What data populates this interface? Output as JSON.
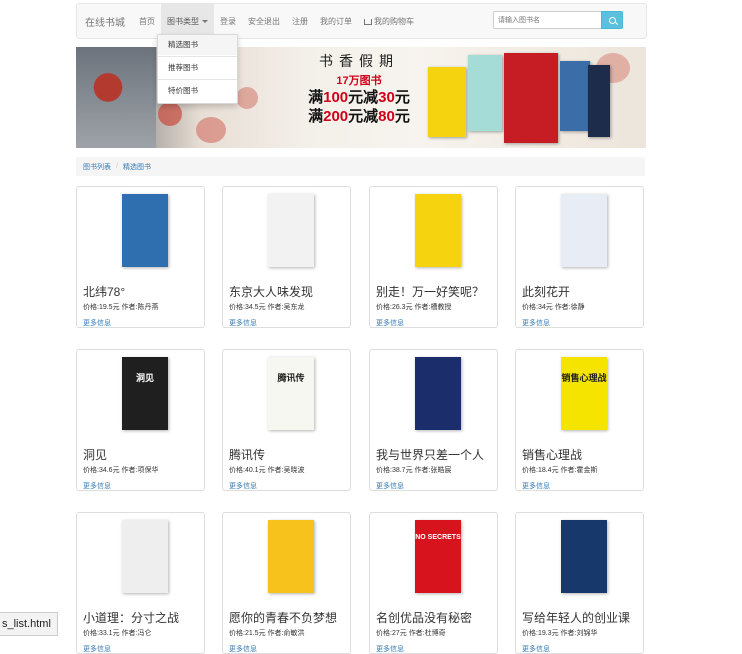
{
  "navbar": {
    "brand": "在线书城",
    "items": [
      "首页",
      "图书类型",
      "登录",
      "安全退出",
      "注册",
      "我的订单",
      "我的购物车"
    ],
    "search_placeholder": "请输入图书名"
  },
  "dropdown": {
    "items": [
      "精选图书",
      "推荐图书",
      "特价图书"
    ]
  },
  "banner": {
    "line1": "书香假期",
    "line2": "17万图书",
    "line3_pre": "满",
    "line3_a": "100",
    "line3_mid": "元减",
    "line3_b": "30",
    "line3_post": "元",
    "line4_pre": "满",
    "line4_a": "200",
    "line4_mid": "元减",
    "line4_b": "80",
    "line4_post": "元"
  },
  "breadcrumb": {
    "home": "图书列表",
    "current": "精选图书"
  },
  "books": [
    {
      "title": "北纬78°",
      "price": "价格:19.5元",
      "author": "作者:陈丹燕",
      "more": "更多信息",
      "cover_color": "#2f6fb0",
      "cover_text": ""
    },
    {
      "title": "东京大人味发现",
      "price": "价格:34.5元",
      "author": "作者:吴东龙",
      "more": "更多信息",
      "cover_color": "#f2f2f2",
      "cover_text": ""
    },
    {
      "title": "别走！万一好笑呢？",
      "price": "价格:26.3元",
      "author": "作者:槽教授",
      "more": "更多信息",
      "cover_color": "#f5d30f",
      "cover_text": ""
    },
    {
      "title": "此刻花开",
      "price": "价格:34元",
      "author": "作者:徐静",
      "more": "更多信息",
      "cover_color": "#e8edf5",
      "cover_text": ""
    },
    {
      "title": "洞见",
      "price": "价格:34.6元",
      "author": "作者:项保华",
      "more": "更多信息",
      "cover_color": "#1f1f1f",
      "cover_text": "洞见"
    },
    {
      "title": "腾讯传",
      "price": "价格:40.1元",
      "author": "作者:吴晓波",
      "more": "更多信息",
      "cover_color": "#f7f7f2",
      "cover_text": "腾讯传"
    },
    {
      "title": "我与世界只差一个人",
      "price": "价格:38.7元",
      "author": "作者:张皓宸",
      "more": "更多信息",
      "cover_color": "#1c2d6b",
      "cover_text": ""
    },
    {
      "title": "销售心理战",
      "price": "价格:18.4元",
      "author": "作者:霍金斯",
      "more": "更多信息",
      "cover_color": "#f4e400",
      "cover_text": "销售心理战"
    },
    {
      "title": "小道理：分寸之战",
      "price": "价格:33.1元",
      "author": "作者:冯仑",
      "more": "更多信息",
      "cover_color": "#eeeeee",
      "cover_text": ""
    },
    {
      "title": "愿你的青春不负梦想",
      "price": "价格:21.5元",
      "author": "作者:俞敏洪",
      "more": "更多信息",
      "cover_color": "#f6c21b",
      "cover_text": ""
    },
    {
      "title": "名创优品没有秘密",
      "price": "价格:27元",
      "author": "作者:杜博奇",
      "more": "更多信息",
      "cover_color": "#d7141e",
      "cover_text": "NO SECRETS"
    },
    {
      "title": "写给年轻人的创业课",
      "price": "价格:19.3元",
      "author": "作者:刘锦华",
      "more": "更多信息",
      "cover_color": "#17386b",
      "cover_text": ""
    }
  ],
  "statusbar": {
    "text": "s_list.html"
  }
}
